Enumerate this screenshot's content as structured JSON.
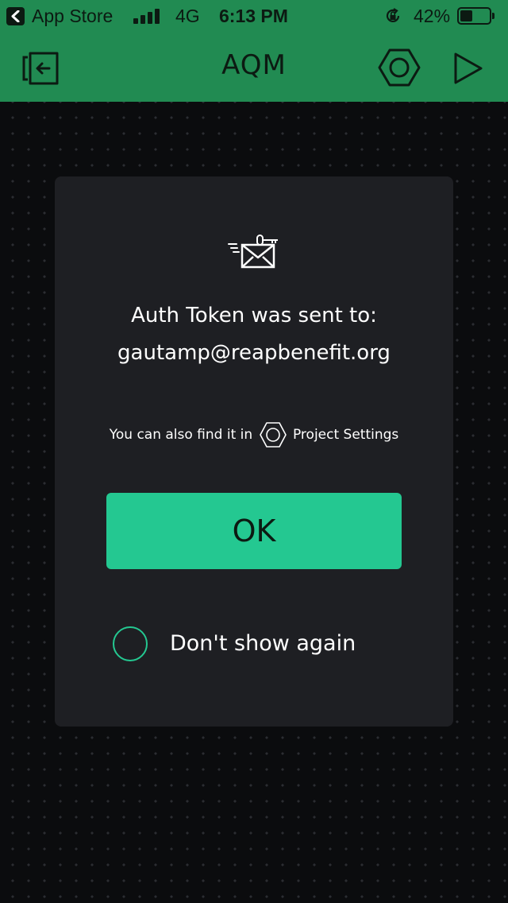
{
  "status_bar": {
    "back_app": "App Store",
    "network": "4G",
    "time": "6:13 PM",
    "battery_percent": "42%",
    "battery_level": 0.42,
    "icons": [
      "back-arrow-icon",
      "signal-bars-icon",
      "rotation-lock-icon",
      "battery-icon"
    ]
  },
  "nav": {
    "title": "AQM",
    "icons": [
      "exit-icon",
      "hexagon-settings-icon",
      "play-icon"
    ],
    "color": "#218b52"
  },
  "dialog": {
    "icon": "envelope-key-icon",
    "message_line1": "Auth Token was sent to:",
    "email": "gautamp@reapbenefit.org",
    "hint_prefix": "You can also find it in",
    "hint_icon": "hexagon-settings-icon",
    "hint_suffix": "Project Settings",
    "ok_label": "OK",
    "dont_show_label": "Don't show again",
    "accent_color": "#24c891"
  }
}
